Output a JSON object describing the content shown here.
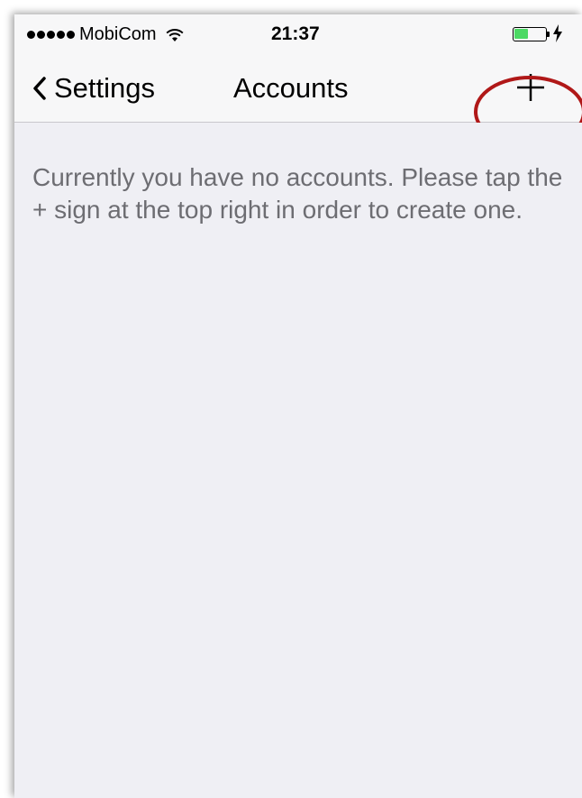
{
  "status_bar": {
    "carrier": "MobiCom",
    "signal_bars": 5,
    "time": "21:37",
    "battery_level": 0.45,
    "charging": true,
    "battery_color": "#4cd964"
  },
  "nav_bar": {
    "back_label": "Settings",
    "title": "Accounts",
    "add_icon": "plus-icon"
  },
  "content": {
    "empty_message": "Currently you have no accounts. Please tap the + sign at the top right in order to create one."
  },
  "annotation": {
    "color": "#b01818"
  }
}
